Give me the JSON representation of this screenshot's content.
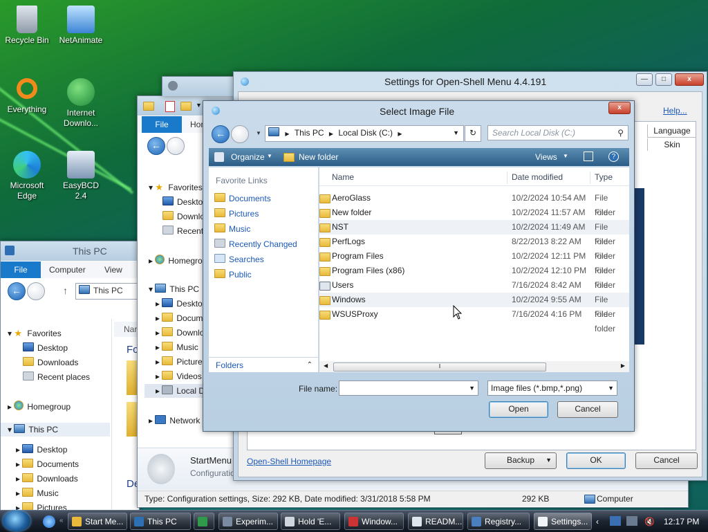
{
  "desktop": {
    "icons": [
      {
        "label": "Recycle Bin"
      },
      {
        "label": "NetAnimate"
      },
      {
        "label": "Everything"
      },
      {
        "label": "Internet Downlo..."
      },
      {
        "label": "Microsoft Edge"
      },
      {
        "label": "EasyBCD 2.4"
      }
    ]
  },
  "explorer_left": {
    "title": "This PC",
    "ribbon_tabs": [
      "File",
      "Computer",
      "View"
    ],
    "address": "This PC",
    "nav": {
      "favorites": "Favorites",
      "desktop": "Desktop",
      "downloads": "Downloads",
      "recent": "Recent places",
      "homegroup": "Homegroup",
      "this_pc": "This PC",
      "pc_desktop": "Desktop",
      "documents": "Documents",
      "pc_downloads": "Downloads",
      "music": "Music",
      "pictures": "Pictures"
    },
    "content_header": "Nar",
    "content_text1": "Fo",
    "content_text2": "De"
  },
  "explorer_mid": {
    "ribbon_tabs": [
      "File",
      "Hom"
    ],
    "nav": {
      "favorites": "Favorites",
      "desktop": "Deskto",
      "downloads": "Downlo",
      "recent": "Recent",
      "homegroup": "Homegro",
      "this_pc": "This PC",
      "pc_desktop": "Deskto",
      "documents": "Docum",
      "pc_downloads": "Downlo",
      "music": "Music",
      "pictures": "Picture",
      "videos": "Videos",
      "local_disk": "Local D",
      "network": "Network"
    },
    "details": {
      "name": "StartMenu",
      "type": "Configuration"
    },
    "status": "Type: Configuration settings, Size: 292 KB, Date modified: 3/31/2018 5:58 PM",
    "status_size": "292 KB",
    "status_location": "Computer"
  },
  "settings": {
    "title": "Settings for Open-Shell Menu 4.4.191",
    "help": "Help...",
    "tabs": [
      "Language",
      "Skin"
    ],
    "homepage_link": "Open-Shell Homepage",
    "backup": "Backup",
    "ok": "OK",
    "cancel": "Cancel"
  },
  "dialog": {
    "title": "Select Image File",
    "close": "x",
    "breadcrumb": [
      "This PC",
      "Local Disk (C:)"
    ],
    "search_placeholder": "Search Local Disk (C:)",
    "toolbar": {
      "organize": "Organize",
      "new_folder": "New folder",
      "views": "Views"
    },
    "favorite_links_header": "Favorite Links",
    "favorite_links": [
      "Documents",
      "Pictures",
      "Music",
      "Recently Changed",
      "Searches",
      "Public"
    ],
    "folders_label": "Folders",
    "columns": {
      "name": "Name",
      "date": "Date modified",
      "type": "Type"
    },
    "files": [
      {
        "name": "AeroGlass",
        "date": "10/2/2024 10:54 AM",
        "type": "File folder"
      },
      {
        "name": "New folder",
        "date": "10/2/2024 11:57 AM",
        "type": "File folder"
      },
      {
        "name": "NST",
        "date": "10/2/2024 11:49 AM",
        "type": "File folder"
      },
      {
        "name": "PerfLogs",
        "date": "8/22/2013 8:22 AM",
        "type": "File folder"
      },
      {
        "name": "Program Files",
        "date": "10/2/2024 12:11 PM",
        "type": "File folder"
      },
      {
        "name": "Program Files (x86)",
        "date": "10/2/2024 12:10 PM",
        "type": "File folder"
      },
      {
        "name": "Users",
        "date": "7/16/2024 8:42 AM",
        "type": "File folder"
      },
      {
        "name": "Windows",
        "date": "10/2/2024 9:55 AM",
        "type": "File folder"
      },
      {
        "name": "WSUSProxy",
        "date": "7/16/2024 4:16 PM",
        "type": "File folder"
      }
    ],
    "file_name_label": "File name:",
    "file_name_value": "",
    "filter": "Image files (*.bmp,*.png)",
    "open": "Open",
    "cancel": "Cancel"
  },
  "taskbar": {
    "items": [
      "Start Me...",
      "This PC",
      "",
      "Experim...",
      "Hold 'E...",
      "Window...",
      "READM...",
      "Registry...",
      "Settings..."
    ],
    "clock": "12:17 PM"
  },
  "colors": {
    "accent": "#1979ca",
    "link": "#1a58b8",
    "close": "#c9402a"
  }
}
